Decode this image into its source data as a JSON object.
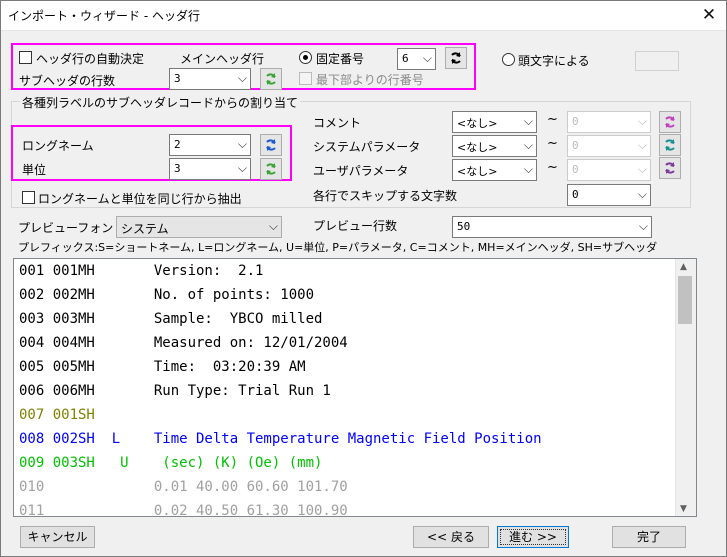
{
  "window": {
    "title": "インポート・ウィザード - ヘッダ行",
    "close_glyph": "✕"
  },
  "header": {
    "auto_detect_label": "ヘッダ行の自動決定",
    "main_header_label": "メインヘッダ行",
    "fixed_number_label": "固定番号",
    "fixed_number_value": "6",
    "from_bottom_label": "最下部よりの行番号",
    "subheader_rows_label": "サブヘッダの行数",
    "subheader_rows_value": "3",
    "first_char_label": "頭文字による"
  },
  "assign": {
    "group_title": "各種列ラベルのサブヘッダレコードからの割り当て",
    "longname_label": "ロングネーム",
    "longname_value": "2",
    "units_label": "単位",
    "units_value": "3",
    "same_row_label": "ロングネームと単位を同じ行から抽出",
    "comment_label": "コメント",
    "comment_value": "<なし>",
    "comment_to": "0",
    "sysparam_label": "システムパラメータ",
    "sysparam_value": "<なし>",
    "sysparam_to": "0",
    "userparam_label": "ユーザパラメータ",
    "userparam_value": "<なし>",
    "userparam_to": "0",
    "skip_chars_label": "各行でスキップする文字数",
    "skip_chars_value": "0",
    "tilde": "~"
  },
  "preview_opts": {
    "font_label": "プレビューフォント",
    "font_value": "システム",
    "rows_label": "プレビュー行数",
    "rows_value": "50",
    "prefix_legend": "プレフィックス:S=ショートネーム, L=ロングネーム, U=単位, P=パラメータ, C=コメント, MH=メインヘッダ, SH=サブヘッダ"
  },
  "preview_lines": [
    {
      "text": "001 001MH       Version:  2.1",
      "color": "#000000"
    },
    {
      "text": "002 002MH       No. of points: 1000",
      "color": "#000000"
    },
    {
      "text": "003 003MH       Sample:  YBCO milled",
      "color": "#000000"
    },
    {
      "text": "004 004MH       Measured on: 12/01/2004",
      "color": "#000000"
    },
    {
      "text": "005 005MH       Time:  03:20:39 AM",
      "color": "#000000"
    },
    {
      "text": "006 006MH       Run Type: Trial Run 1",
      "color": "#000000"
    },
    {
      "text": "007 001SH",
      "color": "#808000"
    },
    {
      "text": "008 002SH  L    Time Delta Temperature Magnetic Field Position",
      "color": "#0000ff"
    },
    {
      "text": "009 003SH   U    (sec) (K) (Oe) (mm)",
      "color": "#00c000"
    },
    {
      "text": "010             0.01 40.00 60.60 101.70",
      "color": "#a0a0a0"
    },
    {
      "text": "011             0.02 40.50 61.30 100.90",
      "color": "#a0a0a0"
    }
  ],
  "buttons": {
    "cancel": "キャンセル",
    "back": "<< 戻る",
    "next": "進む >>",
    "finish": "完了"
  },
  "colors": {
    "highlight": "#ff00ff",
    "refresh_blue": "#1a56d6",
    "refresh_green": "#3aa335",
    "refresh_magenta": "#c040c0",
    "refresh_teal": "#1a9090",
    "refresh_purple": "#7a3a9a"
  }
}
